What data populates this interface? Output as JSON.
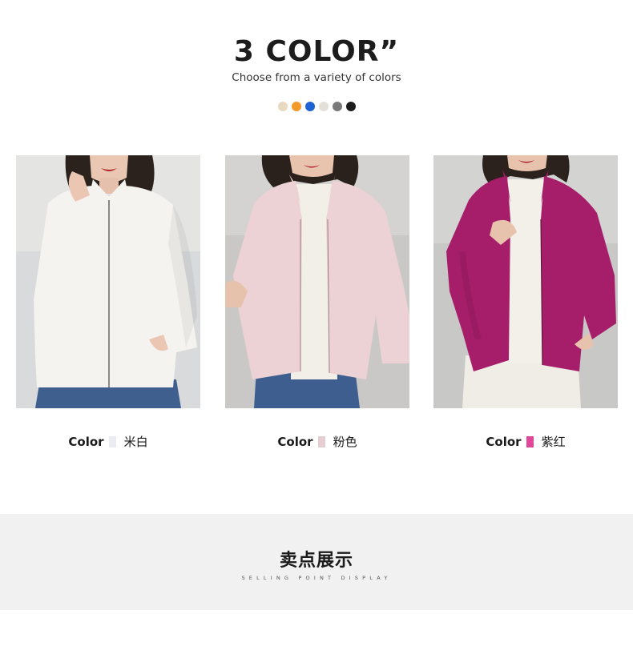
{
  "header": {
    "title": "3 COLOR”",
    "subtitle": "Choose from a variety of colors"
  },
  "swatches": [
    {
      "color": "#e8d9c0"
    },
    {
      "color": "#f39a2b"
    },
    {
      "color": "#1f63d6"
    },
    {
      "color": "#e3e0da"
    },
    {
      "color": "#7a7a7a"
    },
    {
      "color": "#1c1c1c"
    }
  ],
  "products": [
    {
      "color_label": "Color",
      "chip_color": "#e9ecf3",
      "color_name": "米白",
      "jacket_color": "#f4f3ef",
      "image": "woman-white-fleece-jacket"
    },
    {
      "color_label": "Color",
      "chip_color": "#e6cdd1",
      "color_name": "粉色",
      "jacket_color": "#ecd2d4",
      "image": "woman-pink-fleece-jacket"
    },
    {
      "color_label": "Color",
      "chip_color": "#e0479a",
      "color_name": "紫红",
      "jacket_color": "#a61e6a",
      "image": "woman-magenta-fleece-jacket"
    }
  ],
  "section": {
    "title": "卖点展示",
    "subtitle": "SELLING POINT DISPLAY"
  }
}
